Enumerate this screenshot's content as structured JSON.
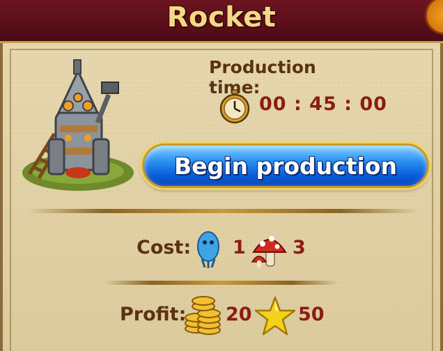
{
  "window": {
    "title": "Rocket"
  },
  "production": {
    "label": "Production time:",
    "time": "00 : 45 : 00",
    "timer_icon": "stopwatch-icon"
  },
  "actions": {
    "begin_label": "Begin production"
  },
  "cost": {
    "label": "Cost:",
    "items": [
      {
        "icon": "blue-creature-icon",
        "amount": "1"
      },
      {
        "icon": "mushroom-icon",
        "amount": "3"
      }
    ]
  },
  "profit": {
    "label": "Profit:",
    "items": [
      {
        "icon": "gold-coins-icon",
        "amount": "20"
      },
      {
        "icon": "star-icon",
        "amount": "50"
      }
    ]
  },
  "colors": {
    "header": "#5a0f1a",
    "title": "#f3d987",
    "panel": "#e3d3a8",
    "label_brown": "#5a3214",
    "value_red": "#8a1d14",
    "button_blue": "#1a72e8"
  }
}
